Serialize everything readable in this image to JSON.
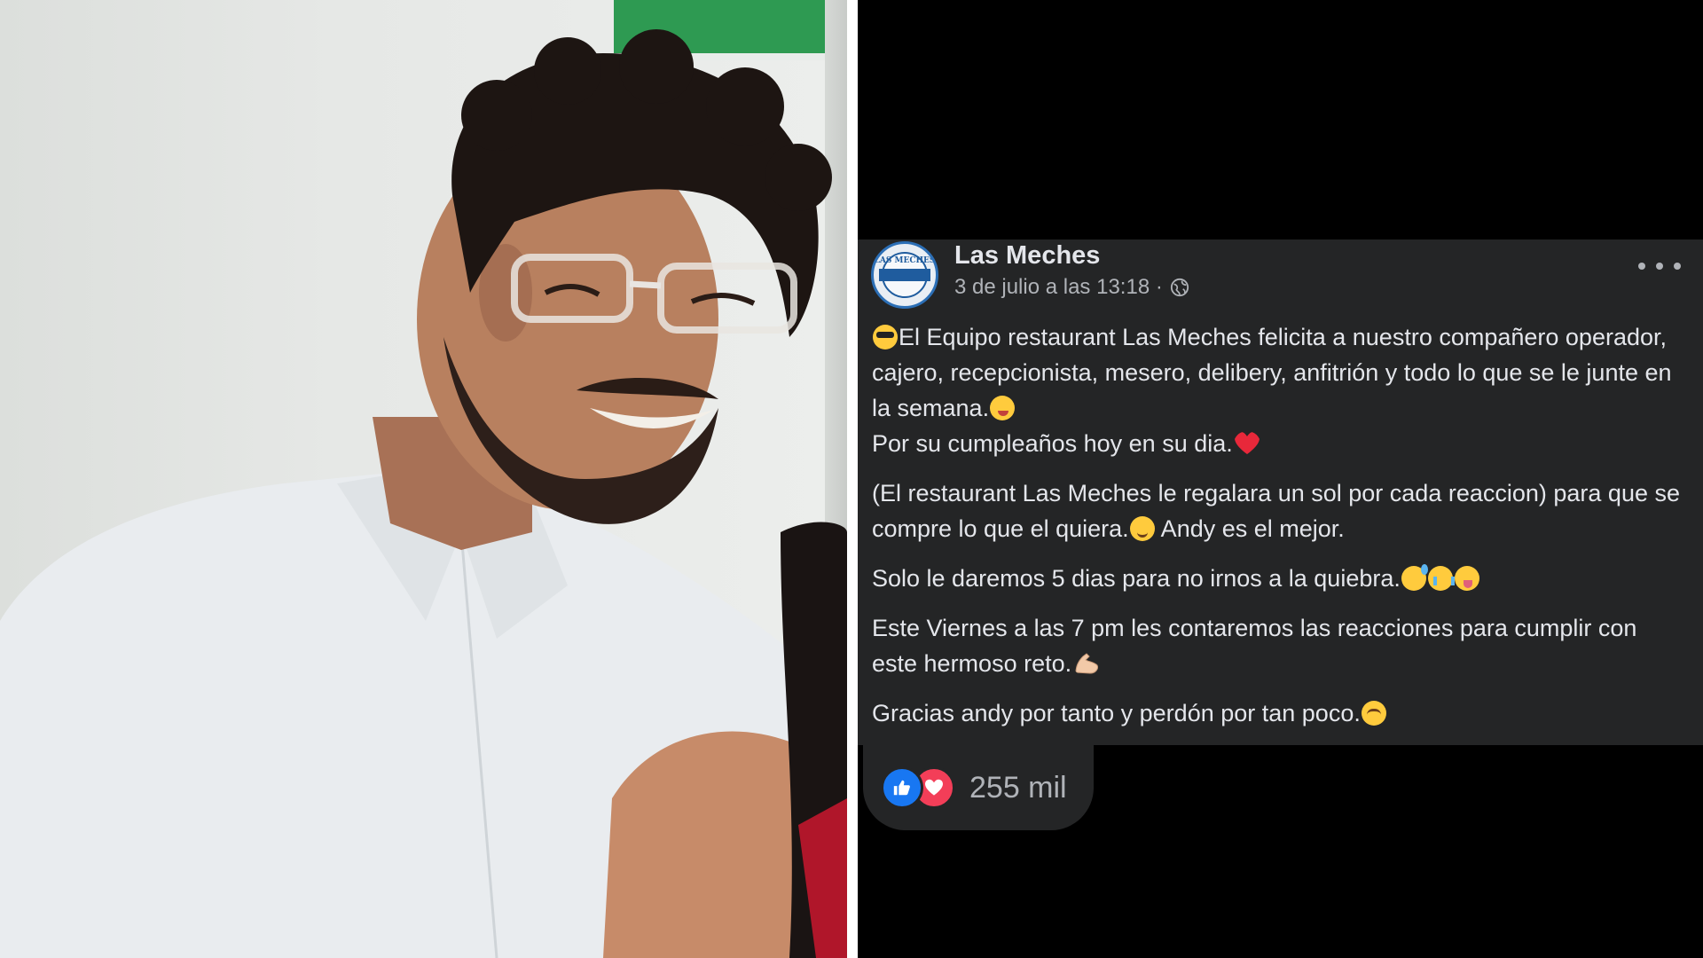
{
  "post": {
    "page_name": "Las Meches",
    "date": "3 de julio a las 13:18 ·",
    "avatar_text": "LAS MECHES",
    "paragraphs": {
      "p1_a": "El Equipo restaurant Las Meches felicita a nuestro compañero operador, cajero, recepcionista, mesero, delibery, anfitrión y todo lo que se le junte en la semana.",
      "p1_b": "Por su cumpleaños hoy en  su dia.",
      "p2_a": "(El restaurant Las Meches le regalara un sol por cada reaccion) para que se compre lo que el quiera.",
      "p2_b": " Andy es el mejor.",
      "p3": "Solo le daremos 5 dias para no irnos a la quiebra.",
      "p4": "Este Viernes a las  7 pm les contaremos las reacciones para cumplir con este hermoso reto.",
      "p5": "Gracias andy por tanto y perdón por tan poco."
    },
    "reactions": {
      "count": "255 mil",
      "types": [
        "like-icon",
        "love-icon"
      ]
    },
    "icons": [
      "globe-icon",
      "more-options-icon",
      "sunglasses-emoji",
      "wink-tongue-emoji",
      "heart-emoji",
      "smile-emoji",
      "sweat-smile-emoji",
      "crying-emoji",
      "flexed-arm-emoji",
      "relieved-emoji"
    ]
  },
  "colors": {
    "post_bg": "#242526",
    "text": "#e4e6eb",
    "secondary_text": "#b0b3b8",
    "like_blue": "#1877f2",
    "love_red": "#f33e58"
  }
}
